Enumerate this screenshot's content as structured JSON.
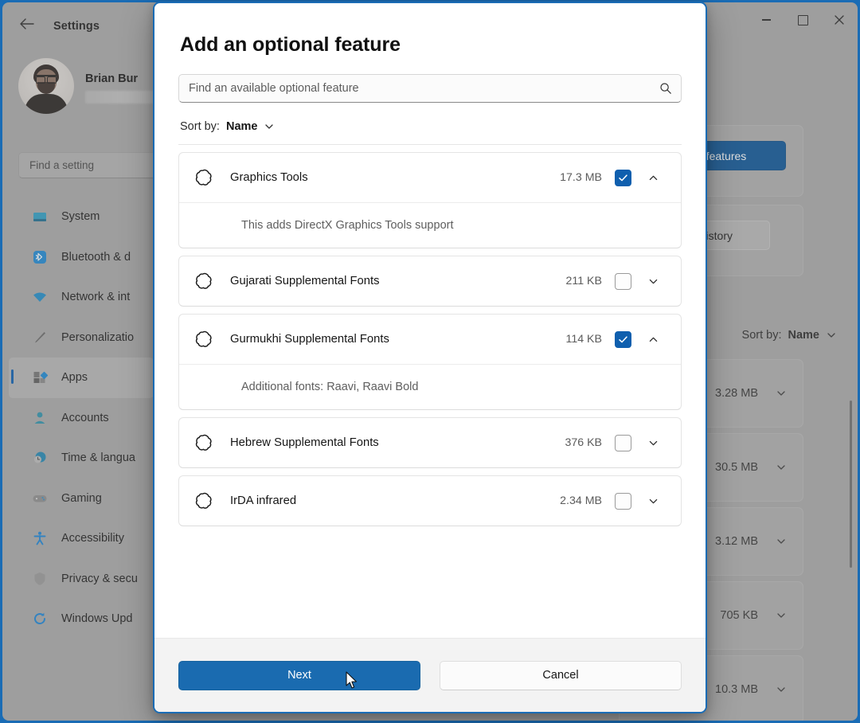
{
  "window": {
    "title": "Settings",
    "back_icon": "back-arrow-icon",
    "caption": {
      "minimize": "minimize-icon",
      "maximize": "maximize-icon",
      "close": "close-icon"
    },
    "profile": {
      "name": "Brian Bur",
      "email_redacted": ""
    },
    "search": {
      "placeholder": "Find a setting"
    },
    "nav": [
      {
        "label": "System",
        "icon": "monitor-icon",
        "active": false
      },
      {
        "label": "Bluetooth & d",
        "icon": "bluetooth-icon",
        "active": false
      },
      {
        "label": "Network & int",
        "icon": "wifi-icon",
        "active": false
      },
      {
        "label": "Personalizatio",
        "icon": "brush-icon",
        "active": false
      },
      {
        "label": "Apps",
        "icon": "apps-icon",
        "active": true
      },
      {
        "label": "Accounts",
        "icon": "person-icon",
        "active": false
      },
      {
        "label": "Time & langua",
        "icon": "clock-icon",
        "active": false
      },
      {
        "label": "Gaming",
        "icon": "gamepad-icon",
        "active": false
      },
      {
        "label": "Accessibility",
        "icon": "accessibility-icon",
        "active": false
      },
      {
        "label": "Privacy & secu",
        "icon": "shield-icon",
        "active": false
      },
      {
        "label": "Windows Upd",
        "icon": "update-icon",
        "active": false
      }
    ],
    "right_panel": {
      "view_features_label": "View features",
      "see_history_label": "See history",
      "sort_prefix": "Sort by:",
      "sort_value": "Name",
      "sizes": [
        "3.28 MB",
        "30.5 MB",
        "3.12 MB",
        "705 KB",
        "10.3 MB"
      ]
    }
  },
  "dialog": {
    "title": "Add an optional feature",
    "search": {
      "placeholder": "Find an available optional feature",
      "icon": "search-icon"
    },
    "sort": {
      "prefix": "Sort by:",
      "value": "Name",
      "icon": "chevron-down-icon"
    },
    "features": [
      {
        "name": "Graphics Tools",
        "size": "17.3 MB",
        "checked": true,
        "expanded": true,
        "description": "This adds DirectX Graphics Tools support",
        "icon": "cog-icon"
      },
      {
        "name": "Gujarati Supplemental Fonts",
        "size": "211 KB",
        "checked": false,
        "expanded": false,
        "description": "",
        "icon": "cog-icon"
      },
      {
        "name": "Gurmukhi Supplemental Fonts",
        "size": "114 KB",
        "checked": true,
        "expanded": true,
        "description": "Additional fonts: Raavi, Raavi Bold",
        "icon": "cog-icon"
      },
      {
        "name": "Hebrew Supplemental Fonts",
        "size": "376 KB",
        "checked": false,
        "expanded": false,
        "description": "",
        "icon": "cog-icon"
      },
      {
        "name": "IrDA infrared",
        "size": "2.34 MB",
        "checked": false,
        "expanded": false,
        "description": "",
        "icon": "cog-icon"
      }
    ],
    "footer": {
      "next_label": "Next",
      "cancel_label": "Cancel"
    }
  },
  "colors": {
    "accent": "#0f5fae",
    "primary_button": "#1a6bb0",
    "window_border": "#1a6cb5",
    "background": "#ababab"
  }
}
